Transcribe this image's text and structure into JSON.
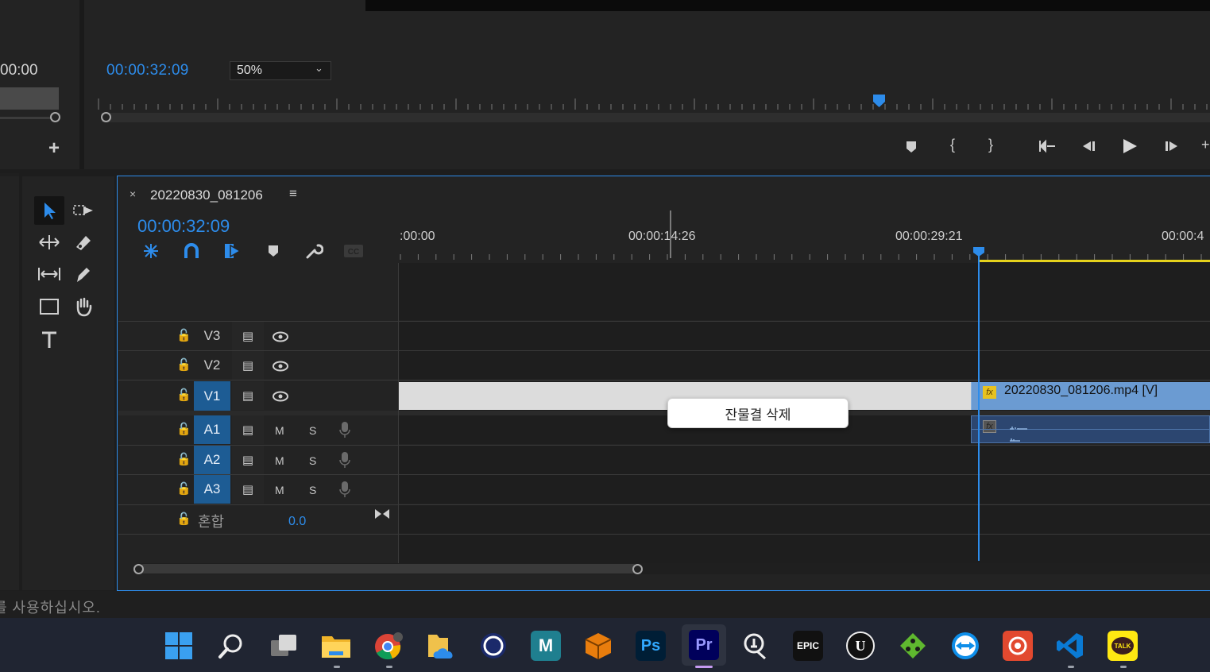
{
  "program_monitor": {
    "left_timecode": "00:00",
    "timecode": "00:00:32:09",
    "zoom": "50%"
  },
  "timeline": {
    "sequence_name": "20220830_081206",
    "timecode": "00:00:32:09",
    "ruler_labels": [
      ":00:00",
      "00:00:14:26",
      "00:00:29:21",
      "00:00:4"
    ],
    "video_tracks": [
      {
        "name": "V3",
        "active": false
      },
      {
        "name": "V2",
        "active": false
      },
      {
        "name": "V1",
        "active": true
      }
    ],
    "audio_tracks": [
      {
        "name": "A1",
        "m": "M",
        "s": "S"
      },
      {
        "name": "A2",
        "m": "M",
        "s": "S"
      },
      {
        "name": "A3",
        "m": "M",
        "s": "S"
      }
    ],
    "mix": {
      "label": "혼합",
      "value": "0.0"
    },
    "clip_video_label": "20220830_081206.mp4 [V]",
    "fx": "fx"
  },
  "context_menu": {
    "item": "잔물결 삭제"
  },
  "status_bar": {
    "text": "를 사용하십시오."
  },
  "taskbar": {
    "apps": [
      {
        "name": "windows-start",
        "label": ""
      },
      {
        "name": "search",
        "label": ""
      },
      {
        "name": "task-view",
        "label": ""
      },
      {
        "name": "file-explorer",
        "label": ""
      },
      {
        "name": "chrome",
        "label": ""
      },
      {
        "name": "onedrive-folder",
        "label": ""
      },
      {
        "name": "cinema4d",
        "label": ""
      },
      {
        "name": "maya",
        "label": "M"
      },
      {
        "name": "blender-box",
        "label": ""
      },
      {
        "name": "photoshop",
        "label": "Ps"
      },
      {
        "name": "premiere",
        "label": "Pr"
      },
      {
        "name": "reality-capture",
        "label": ""
      },
      {
        "name": "epic-games",
        "label": "EPIC"
      },
      {
        "name": "unreal",
        "label": "U"
      },
      {
        "name": "sourcetree",
        "label": ""
      },
      {
        "name": "teamviewer",
        "label": ""
      },
      {
        "name": "obs-record",
        "label": ""
      },
      {
        "name": "vscode",
        "label": ""
      },
      {
        "name": "kakaotalk",
        "label": "TALK"
      }
    ]
  },
  "colors": {
    "accent": "#2d8ceb",
    "work_area": "#e6d21c",
    "clip_video": "#6b9bd2",
    "track_active": "#1d5c94"
  }
}
